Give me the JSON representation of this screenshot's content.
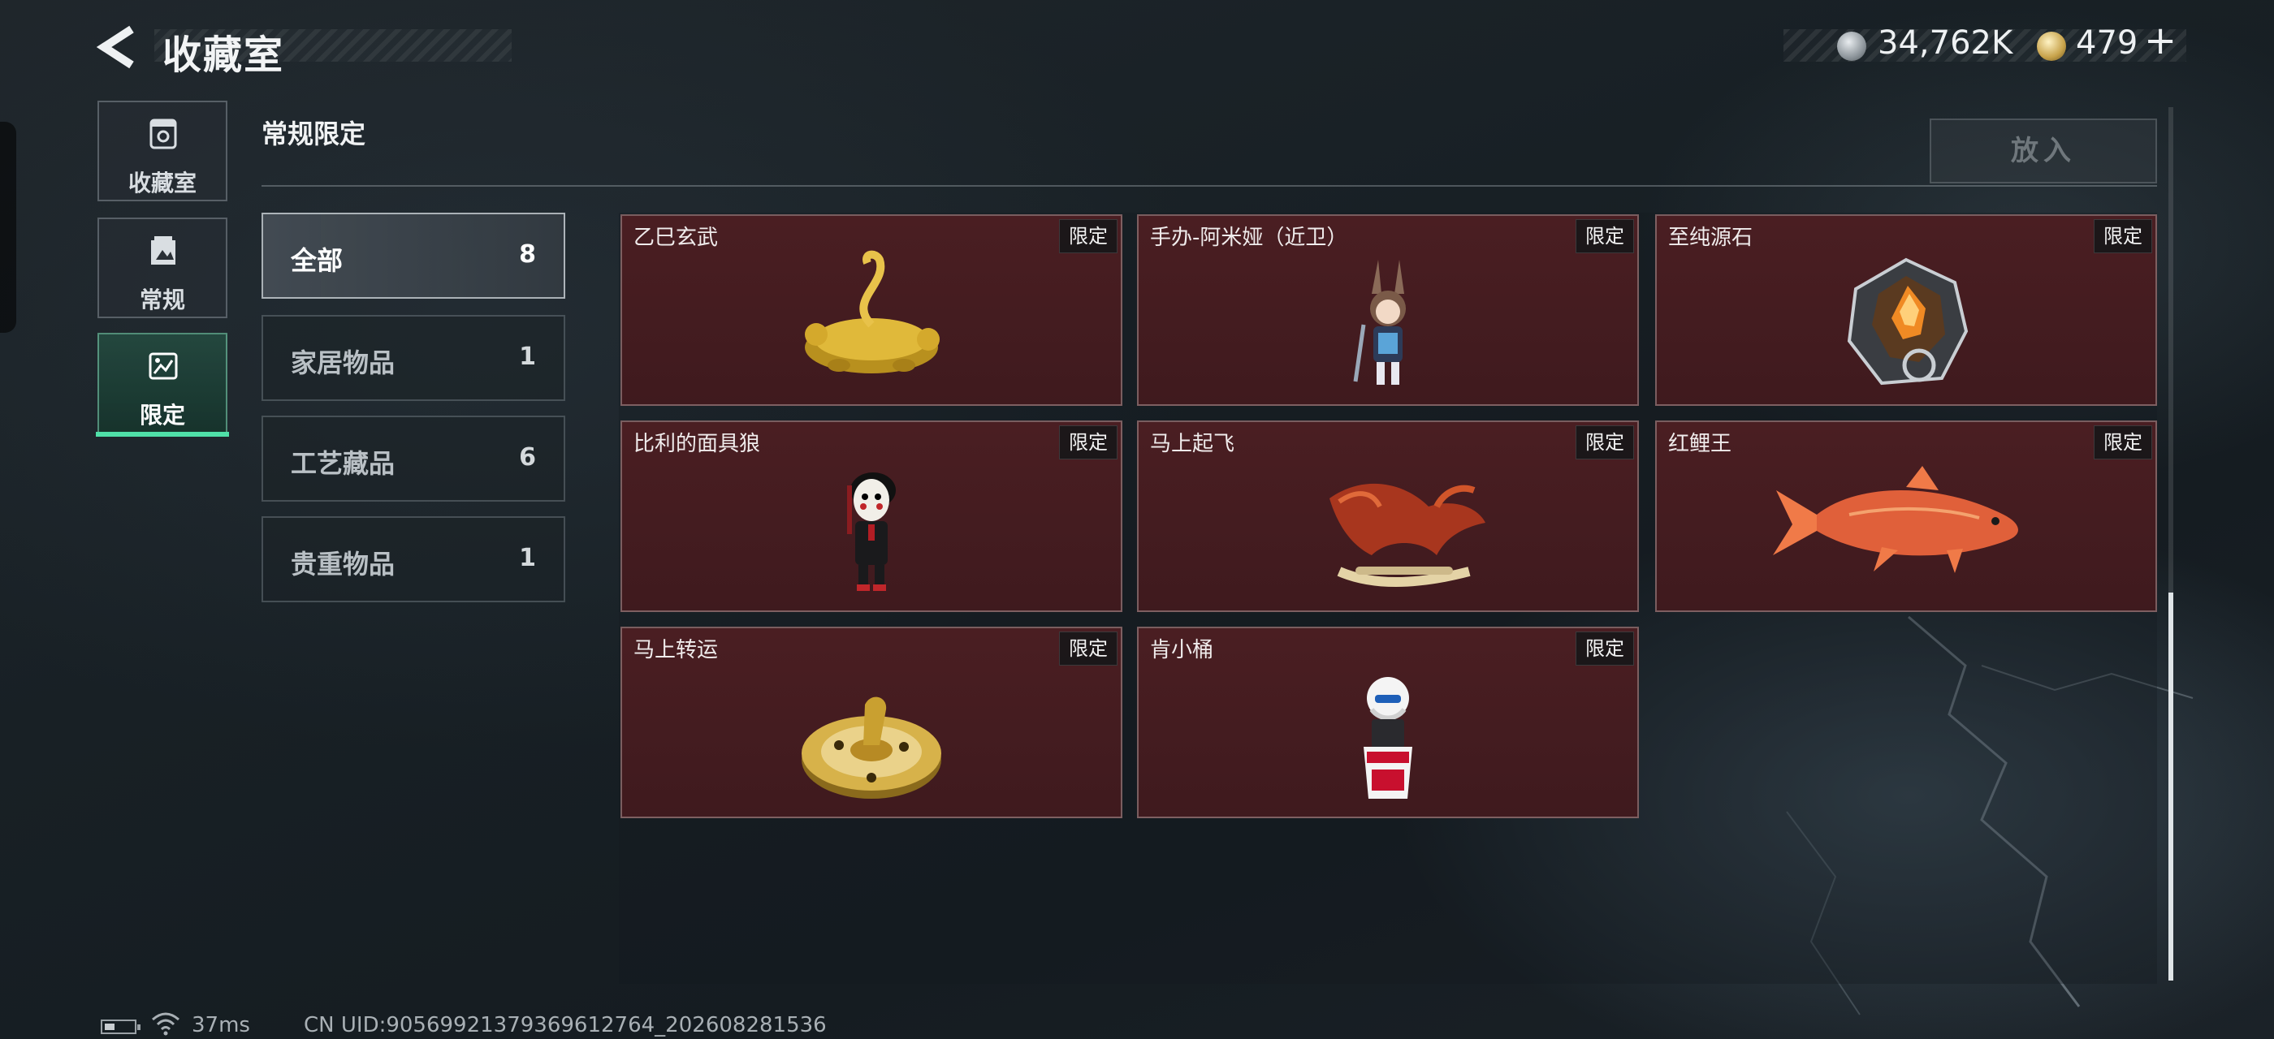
{
  "header": {
    "title": "收藏室",
    "currencies": [
      {
        "icon": "silver-coin-icon",
        "value": "34,762K"
      },
      {
        "icon": "gold-coin-icon",
        "value": "479"
      }
    ],
    "add_label": "+"
  },
  "sidebar": {
    "items": [
      {
        "label": "收藏室",
        "icon": "collection-room-icon",
        "active": false
      },
      {
        "label": "常规",
        "icon": "regular-icon",
        "active": false
      },
      {
        "label": "限定",
        "icon": "limited-icon",
        "active": true
      }
    ]
  },
  "section": {
    "title": "常规限定",
    "put_button": "放入"
  },
  "categories": [
    {
      "name": "全部",
      "count": "8",
      "active": true
    },
    {
      "name": "家居物品",
      "count": "1",
      "active": false
    },
    {
      "name": "工艺藏品",
      "count": "6",
      "active": false
    },
    {
      "name": "贵重物品",
      "count": "1",
      "active": false
    }
  ],
  "items": [
    {
      "name": "乙巳玄武",
      "tag": "限定",
      "art": "gold-tortoise-snake"
    },
    {
      "name": "手办-阿米娅（近卫）",
      "tag": "限定",
      "art": "figure-amiya"
    },
    {
      "name": "至纯源石",
      "tag": "限定",
      "art": "originium-crystal"
    },
    {
      "name": "比利的面具狼",
      "tag": "限定",
      "art": "billy-puppet"
    },
    {
      "name": "马上起飞",
      "tag": "限定",
      "art": "red-horse"
    },
    {
      "name": "红鲤王",
      "tag": "限定",
      "art": "red-carp"
    },
    {
      "name": "马上转运",
      "tag": "限定",
      "art": "gold-horse-disc"
    },
    {
      "name": "肯小桶",
      "tag": "限定",
      "art": "kfc-bucket-figure"
    }
  ],
  "footer": {
    "ping": "37ms",
    "uid": "CN UID:9056992137936961276​4_202608281536"
  }
}
